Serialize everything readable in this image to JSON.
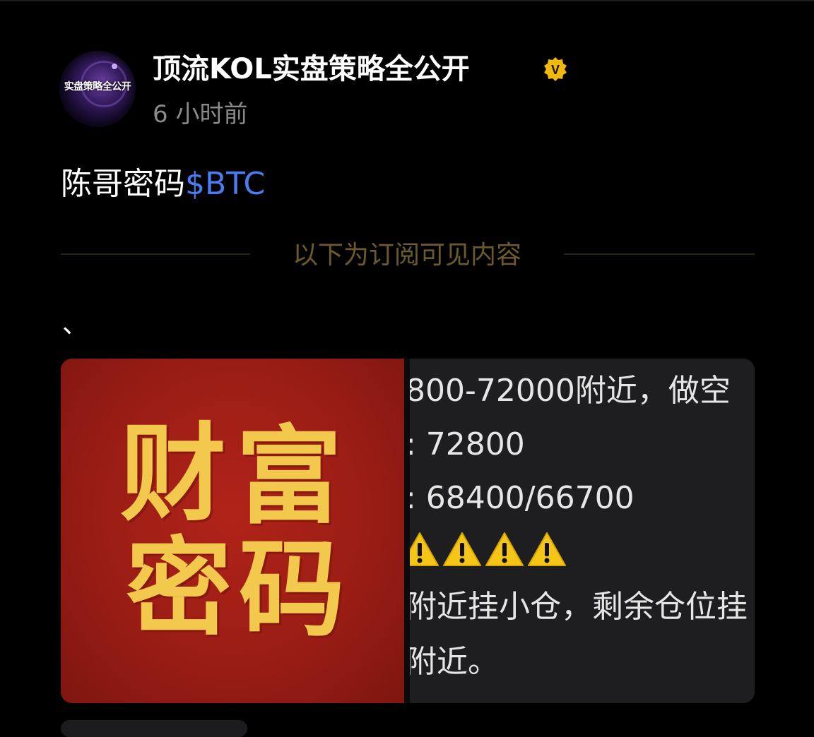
{
  "post": {
    "author": {
      "name": "顶流KOL实盘策略全公开",
      "avatar_text": "实盘策略全公开",
      "verified_icon": "verified-badge-icon",
      "badge_letter": "V"
    },
    "time": "6 小时前",
    "text": "陈哥密码",
    "ticker": "$BTC",
    "subscription_divider": "以下为订阅可见内容",
    "stray_text": "、"
  },
  "images": {
    "poster": {
      "chars": [
        "财",
        "富",
        "密",
        "码"
      ],
      "background_color": "#9a1d15",
      "text_color": "#f2c94c"
    },
    "screenshot": {
      "lines": [
        "800-72000附近，做空",
        ": 72800",
        ": 68400/66700",
        "附近挂小仓，剩余仓位挂",
        "附近。"
      ],
      "warning_icon": "warning-icon",
      "warning_count": 4
    }
  },
  "colors": {
    "background": "#000000",
    "ticker_link": "#4b7df2",
    "divider_text": "#6d5a2c",
    "verified_badge": "#f0b90b"
  }
}
